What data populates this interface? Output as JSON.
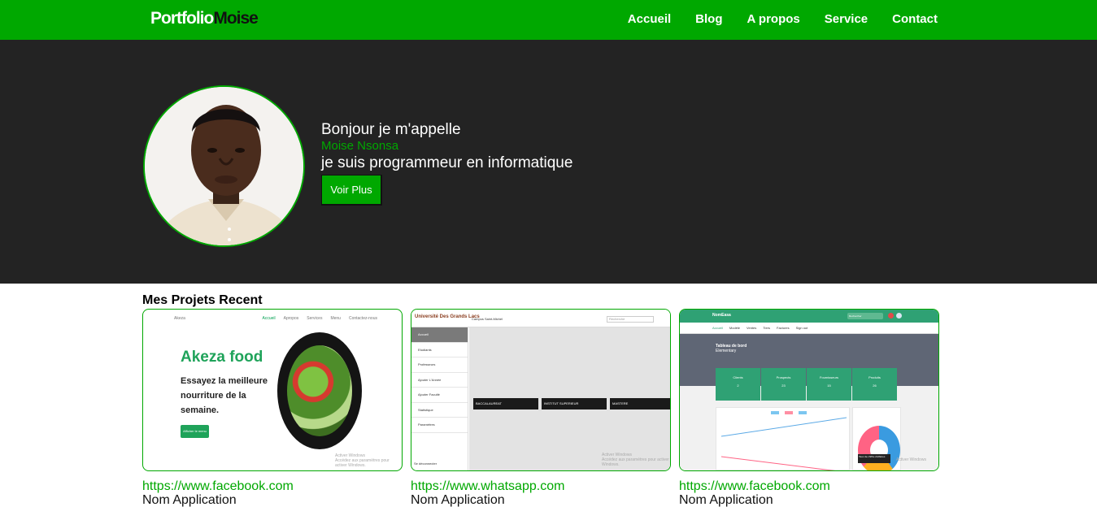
{
  "brand": {
    "part1": "Portfolio",
    "part2": "Moise"
  },
  "nav": [
    "Accueil",
    "Blog",
    "A propos",
    "Service",
    "Contact"
  ],
  "hero": {
    "greeting": "Bonjour je m'appelle",
    "name": "Moise Nsonsa",
    "role": "je suis programmeur en informatique",
    "button": "Voir Plus"
  },
  "projects": {
    "title": "Mes Projets Recent",
    "items": [
      {
        "link": "https://www.facebook.com",
        "app": "Nom Application"
      },
      {
        "link": "https://www.whatsapp.com",
        "app": "Nom Application"
      },
      {
        "link": "https://www.facebook.com",
        "app": "Nom Application"
      }
    ]
  },
  "thumb1": {
    "site": "Akeza",
    "menu": [
      "Accueil",
      "Apropos",
      "Services",
      "Menu",
      "Contactez-nous"
    ],
    "title": "Akeza food",
    "subtitle": "Essayez la meilleure nourriture de la semaine.",
    "button": "Afficher le menu",
    "watermark1": "Activer Windows",
    "watermark2": "Accédez aux paramètres pour activer Windows."
  },
  "thumb2": {
    "brand": "Université Des Grands Lacs",
    "campus": "Campus Saint-Michel",
    "search": "Recherche",
    "menu": [
      "Accueil",
      "Etudiants",
      "Professeurs",
      "Ajouter L'Année",
      "Ajouter Faculté",
      "Statistique",
      "Paramètres"
    ],
    "footer": "Se déconnecter",
    "boxes": [
      "BACCALAUREAT",
      "INSTITUT SUPERIEUR",
      "MASTERE"
    ],
    "watermark1": "Activer Windows",
    "watermark2": "Accédez aux paramètres pour activer Windows."
  },
  "thumb3": {
    "logo": "NomEasa",
    "search": "Rechercher",
    "menu": [
      "Accueil",
      "Modèle",
      "Ventes",
      "Tiers",
      "Factures",
      "Sign out"
    ],
    "heading": "Tableau de bord",
    "subheading": "Elementary",
    "stats": [
      {
        "label": "Clients",
        "value": "2"
      },
      {
        "label": "Prospects",
        "value": "23"
      },
      {
        "label": "Fournisseurs",
        "value": "15"
      },
      {
        "label": "Produits",
        "value": "26"
      }
    ],
    "tooltip": "Taux de chiffre d'affaires",
    "watermark": "Activer Windows"
  },
  "colors": {
    "accent": "#00a800",
    "hero_bg": "#232323"
  }
}
